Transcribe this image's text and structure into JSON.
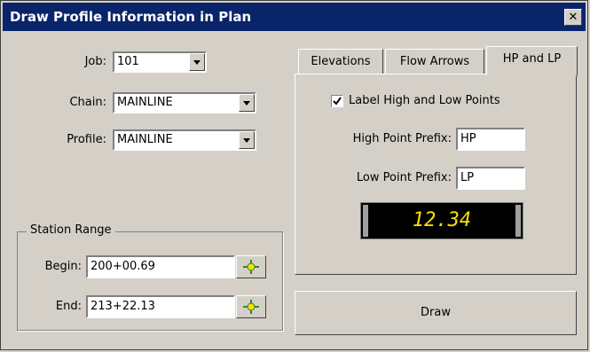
{
  "window": {
    "title": "Draw Profile Information in Plan",
    "close_glyph": "✕"
  },
  "fields": {
    "job": {
      "label": "Job:",
      "value": "101"
    },
    "chain": {
      "label": "Chain:",
      "value": "MAINLINE"
    },
    "profile": {
      "label": "Profile:",
      "value": "MAINLINE"
    }
  },
  "station_range": {
    "title": "Station Range",
    "begin": {
      "label": "Begin:",
      "value": "200+00.69",
      "pick_icon": "crosshair-pick-icon"
    },
    "end": {
      "label": "End:",
      "value": "213+22.13",
      "pick_icon": "crosshair-pick-icon"
    }
  },
  "tabs": [
    {
      "label": "Elevations",
      "active": false
    },
    {
      "label": "Flow Arrows",
      "active": false
    },
    {
      "label": "HP and LP",
      "active": true
    }
  ],
  "hp_lp": {
    "checkbox_label": "Label High and Low Points",
    "checkbox_checked": true,
    "high_prefix": {
      "label": "High Point Prefix:",
      "value": "HP"
    },
    "low_prefix": {
      "label": "Low Point Prefix:",
      "value": "LP"
    },
    "preview_value": "12.34"
  },
  "actions": {
    "draw_label": "Draw"
  },
  "colors": {
    "titlebar": "#0a246a",
    "dialog_bg": "#d4d0c8",
    "display_text": "#ffdd00",
    "pick_icon": "#2a8a2a"
  }
}
